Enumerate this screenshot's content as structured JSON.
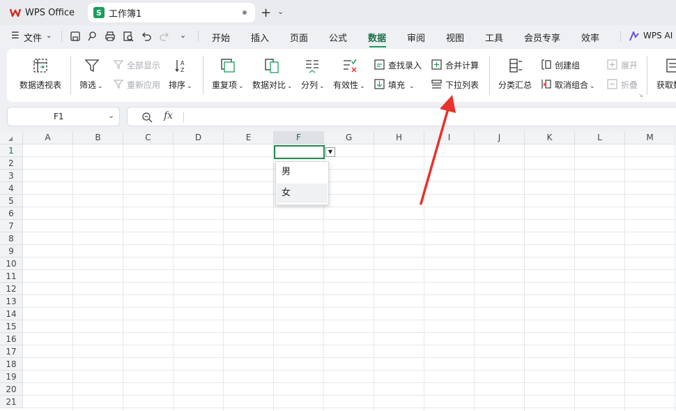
{
  "tabs": {
    "wps_label": "WPS Office",
    "doc_label": "工作簿1",
    "doc_icon_letter": "S"
  },
  "menu": {
    "file": "文件",
    "items": [
      "开始",
      "插入",
      "页面",
      "公式",
      "数据",
      "审阅",
      "视图",
      "工具",
      "会员专享",
      "效率"
    ],
    "active": "数据",
    "ai": "WPS AI"
  },
  "ribbon": {
    "pivot": "数据透视表",
    "filter": "筛选",
    "show_all": "全部显示",
    "reapply": "重新应用",
    "sort": "排序",
    "duplicates": "重复项",
    "compare": "数据对比",
    "split": "分列",
    "validity": "有效性",
    "lookup_entry": "查找录入",
    "fill": "填充",
    "consolidate": "合并计算",
    "dropdown_list": "下拉列表",
    "subtotal": "分类汇总",
    "create_group": "创建组",
    "ungroup": "取消组合",
    "expand": "展开",
    "collapse": "折叠",
    "get_data": "获取数"
  },
  "formula": {
    "cell_ref": "F1",
    "fx": "fx"
  },
  "grid": {
    "columns": [
      "A",
      "B",
      "C",
      "D",
      "E",
      "F",
      "G",
      "H",
      "I",
      "J",
      "K",
      "L",
      "M"
    ],
    "rows": [
      "1",
      "2",
      "3",
      "4",
      "5",
      "6",
      "7",
      "8",
      "9",
      "10",
      "11",
      "12",
      "13",
      "14",
      "15",
      "16",
      "17",
      "18",
      "19",
      "20",
      "21"
    ],
    "selected_column": "F",
    "selected_row": "1"
  },
  "dropdown": {
    "options": [
      "男",
      "女"
    ],
    "highlighted": "女"
  },
  "colors": {
    "accent": "#1a9e5c",
    "selection": "#1f8a4a",
    "arrow": "#e8322b"
  }
}
